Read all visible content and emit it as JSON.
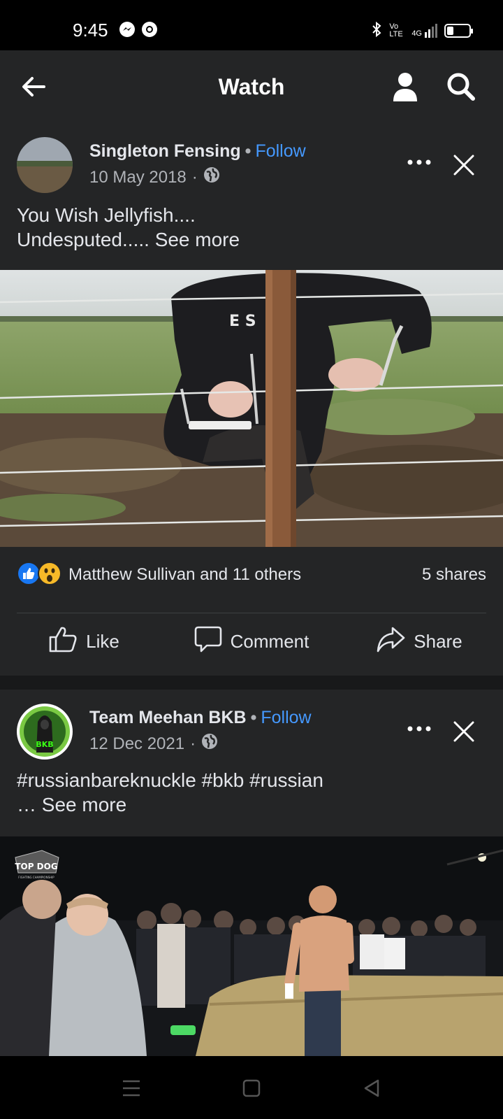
{
  "status_bar": {
    "time": "9:45",
    "left_icons": [
      "messenger-icon",
      "chrome-icon"
    ],
    "right_icons": [
      "bluetooth-icon",
      "volte-icon",
      "signal-4g-icon",
      "battery-icon"
    ],
    "network_label": "4G",
    "volte_label": "Vo LTE",
    "battery_level": 0.3
  },
  "header": {
    "title": "Watch",
    "back_icon": "arrow-left-icon",
    "profile_icon": "person-icon",
    "search_icon": "search-icon"
  },
  "posts": [
    {
      "author": "Singleton Fensing",
      "follow_label": "Follow",
      "separator": "•",
      "date": "10 May 2018",
      "date_separator": "·",
      "privacy_icon": "globe-icon",
      "text_line1": "You Wish Jellyfish....",
      "text_line2": "Undesputed.....",
      "see_more": "See more",
      "media_icon_text": "E S"
    },
    {
      "author": "Team Meehan BKB",
      "follow_label": "Follow",
      "separator": "•",
      "date": "12 Dec 2021",
      "date_separator": "·",
      "privacy_icon": "globe-icon",
      "text_line1": "#russianbareknuckle #bkb #russian",
      "text_line2": "…",
      "see_more": "See more",
      "avatar_text": "BKB",
      "media_logo_text": "TOP DOG",
      "media_logo_subtext": "FIGHTING CHAMPIONSHIP"
    }
  ],
  "engagement": {
    "reaction_icons": [
      "like-reaction-icon",
      "wow-reaction-icon"
    ],
    "reaction_text": "Matthew Sullivan and 11 others",
    "shares": "5 shares",
    "actions": [
      {
        "label": "Like",
        "icon": "thumbs-up-icon"
      },
      {
        "label": "Comment",
        "icon": "comment-icon"
      },
      {
        "label": "Share",
        "icon": "share-icon"
      }
    ]
  },
  "nav_bar": {
    "icons": [
      "menu-icon",
      "home-square-icon",
      "back-triangle-icon"
    ]
  },
  "colors": {
    "background": "#18191a",
    "surface": "#242526",
    "text": "#e4e6eb",
    "secondary_text": "#b0b3b8",
    "link": "#4599ff"
  }
}
